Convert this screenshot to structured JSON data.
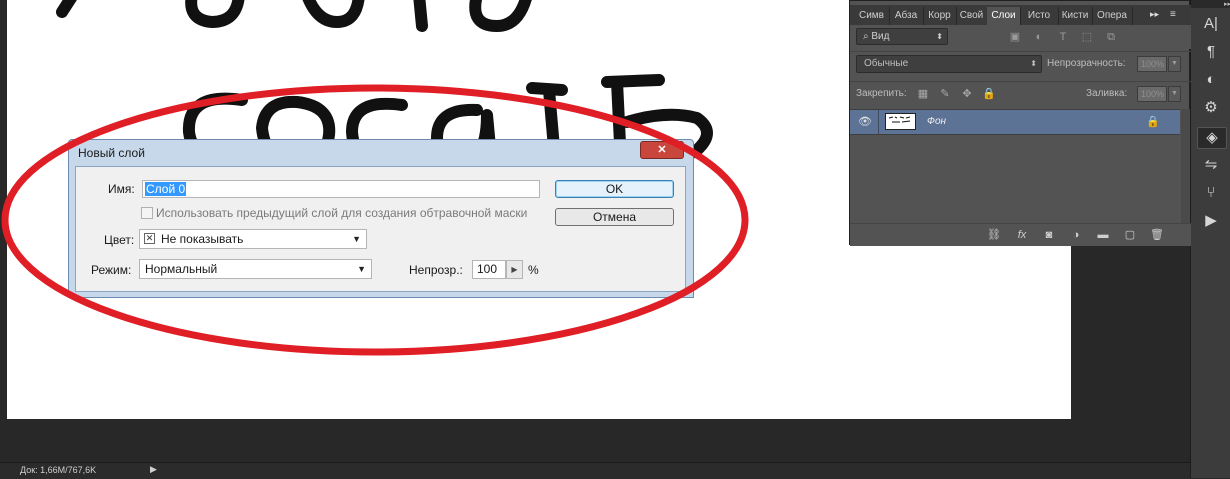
{
  "canvas": {
    "handwriting_top": "ЛОБЛО",
    "handwriting_main": "сосать"
  },
  "status_bar": {
    "doc_info": "Док: 1,66M/767,6K",
    "arrow": "▶"
  },
  "layers_panel": {
    "tabs": [
      {
        "label": "Симв",
        "active": false
      },
      {
        "label": "Абза",
        "active": false
      },
      {
        "label": "Корр",
        "active": false
      },
      {
        "label": "Свой",
        "active": false
      },
      {
        "label": "Слои",
        "active": true
      },
      {
        "label": "Исто",
        "active": false
      },
      {
        "label": "Кисти",
        "active": false
      },
      {
        "label": "Опера",
        "active": false
      }
    ],
    "collapse_icon": "▸▸",
    "menu_icon": "≡",
    "filter_kind": "Вид",
    "filter_kind_icon": "⌕",
    "filter_icons": [
      "▣",
      "◐",
      "T",
      "⬚",
      "⧉"
    ],
    "blend_mode": "Обычные",
    "opacity_label": "Непрозрачность:",
    "opacity_value": "100%",
    "lock_label": "Закрепить:",
    "lock_icons": [
      "▦",
      "✎",
      "✥",
      "🔒"
    ],
    "fill_label": "Заливка:",
    "fill_value": "100%",
    "layers": [
      {
        "name": "Фон",
        "visible": true,
        "locked": true
      }
    ],
    "bottom_icons": [
      "⛓",
      "fx",
      "◙",
      "◑",
      "▬",
      "▢",
      "🗑"
    ]
  },
  "right_toolbar": {
    "icons": [
      "A|",
      "¶",
      "◐",
      "⚙",
      "◈",
      "⇋",
      "⑂",
      "▶"
    ]
  },
  "dialog": {
    "title": "Новый слой",
    "close_label": "✕",
    "name_label": "Имя:",
    "name_value": "Слой 0",
    "clipping_mask_label": "Использовать предыдущий слой для создания обтравочной маски",
    "color_label": "Цвет:",
    "color_value": "Не показывать",
    "mode_label": "Режим:",
    "mode_value": "Нормальный",
    "opacity_label": "Непрозр.:",
    "opacity_value": "100",
    "opacity_unit": "%",
    "ok_label": "OK",
    "cancel_label": "Отмена"
  },
  "colors": {
    "annotation_circle": "#e01e25",
    "layer_selected": "#5d7395",
    "panel_bg": "#535353",
    "app_bg": "#282828"
  }
}
